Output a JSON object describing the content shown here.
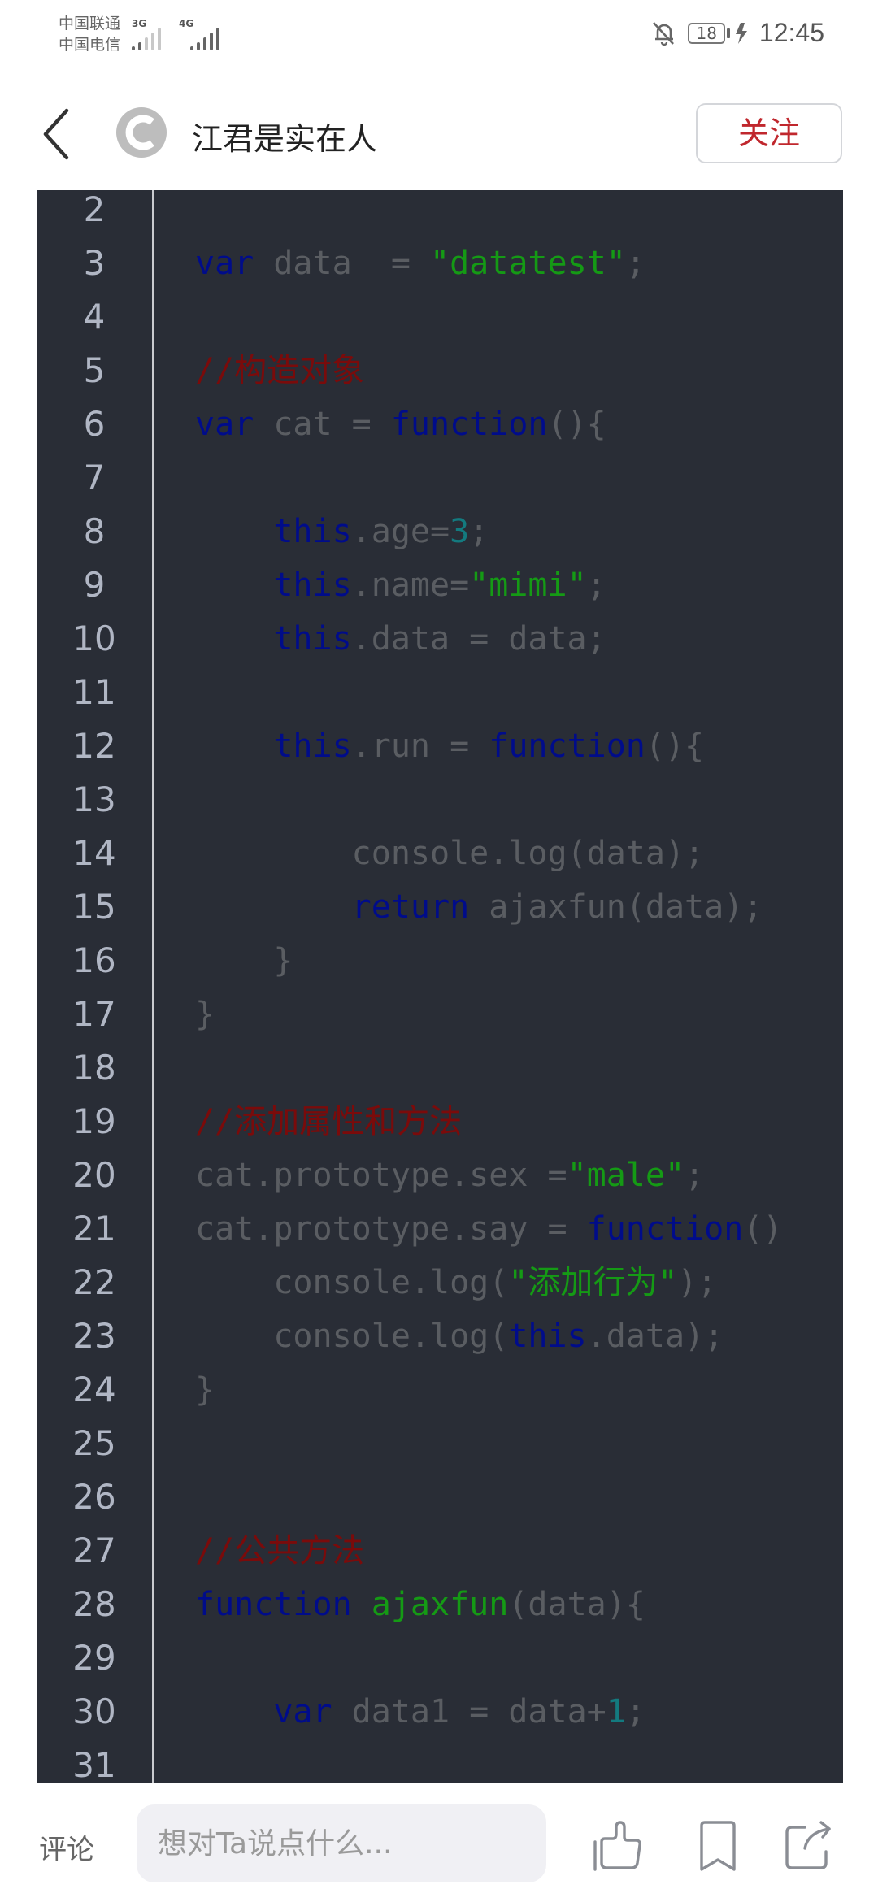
{
  "status_bar": {
    "carrier_1": "中国联通",
    "carrier_2": "中国电信",
    "network_1": "3G",
    "network_2": "4G",
    "icons": [
      "signal-3g-icon",
      "signal-4g-icon",
      "mute-bell-icon",
      "battery-icon",
      "charging-icon"
    ],
    "battery_level": "18",
    "time": "12:45"
  },
  "header": {
    "back_icon": "chevron-left-icon",
    "avatar_icon": "c-logo-avatar",
    "author_name": "江君是实在人",
    "follow_label": "关注",
    "follow_color": "#c0272d"
  },
  "code": {
    "colors": {
      "background": "#292d36",
      "keyword": "#000c8a",
      "string": "#159a15",
      "number": "#137a7f",
      "comment": "#7a0b0b",
      "plain": "#5a5d62",
      "line_number": "#b0b6c4"
    },
    "lines": [
      {
        "n": "2",
        "tokens": []
      },
      {
        "n": "3",
        "tokens": [
          {
            "t": "kw",
            "v": "var"
          },
          {
            "t": "pl",
            "v": " data  = "
          },
          {
            "t": "str",
            "v": "\"datatest\""
          },
          {
            "t": "pl",
            "v": ";"
          }
        ]
      },
      {
        "n": "4",
        "tokens": []
      },
      {
        "n": "5",
        "tokens": [
          {
            "t": "cm",
            "v": "//构造对象"
          }
        ]
      },
      {
        "n": "6",
        "tokens": [
          {
            "t": "kw",
            "v": "var"
          },
          {
            "t": "pl",
            "v": " cat = "
          },
          {
            "t": "kw",
            "v": "function"
          },
          {
            "t": "pl",
            "v": "(){"
          }
        ]
      },
      {
        "n": "7",
        "tokens": []
      },
      {
        "n": "8",
        "tokens": [
          {
            "t": "pl",
            "v": "    "
          },
          {
            "t": "kw",
            "v": "this"
          },
          {
            "t": "pl",
            "v": ".age="
          },
          {
            "t": "num",
            "v": "3"
          },
          {
            "t": "pl",
            "v": ";"
          }
        ]
      },
      {
        "n": "9",
        "tokens": [
          {
            "t": "pl",
            "v": "    "
          },
          {
            "t": "kw",
            "v": "this"
          },
          {
            "t": "pl",
            "v": ".name="
          },
          {
            "t": "str",
            "v": "\"mimi\""
          },
          {
            "t": "pl",
            "v": ";"
          }
        ]
      },
      {
        "n": "10",
        "tokens": [
          {
            "t": "pl",
            "v": "    "
          },
          {
            "t": "kw",
            "v": "this"
          },
          {
            "t": "pl",
            "v": ".data = data;"
          }
        ]
      },
      {
        "n": "11",
        "tokens": []
      },
      {
        "n": "12",
        "tokens": [
          {
            "t": "pl",
            "v": "    "
          },
          {
            "t": "kw",
            "v": "this"
          },
          {
            "t": "pl",
            "v": ".run = "
          },
          {
            "t": "kw",
            "v": "function"
          },
          {
            "t": "pl",
            "v": "(){"
          }
        ]
      },
      {
        "n": "13",
        "tokens": []
      },
      {
        "n": "14",
        "tokens": [
          {
            "t": "pl",
            "v": "        console.log(data);"
          }
        ]
      },
      {
        "n": "15",
        "tokens": [
          {
            "t": "pl",
            "v": "        "
          },
          {
            "t": "kw",
            "v": "return"
          },
          {
            "t": "pl",
            "v": " ajaxfun(data);"
          }
        ]
      },
      {
        "n": "16",
        "tokens": [
          {
            "t": "pl",
            "v": "    }"
          }
        ]
      },
      {
        "n": "17",
        "tokens": [
          {
            "t": "pl",
            "v": "}"
          }
        ]
      },
      {
        "n": "18",
        "tokens": []
      },
      {
        "n": "19",
        "tokens": [
          {
            "t": "cm",
            "v": "//添加属性和方法"
          }
        ]
      },
      {
        "n": "20",
        "tokens": [
          {
            "t": "pl",
            "v": "cat.prototype.sex ="
          },
          {
            "t": "str",
            "v": "\"male\""
          },
          {
            "t": "pl",
            "v": ";"
          }
        ]
      },
      {
        "n": "21",
        "tokens": [
          {
            "t": "pl",
            "v": "cat.prototype.say = "
          },
          {
            "t": "kw",
            "v": "function"
          },
          {
            "t": "pl",
            "v": "()"
          }
        ]
      },
      {
        "n": "22",
        "tokens": [
          {
            "t": "pl",
            "v": "    console.log("
          },
          {
            "t": "str",
            "v": "\"添加行为\""
          },
          {
            "t": "pl",
            "v": ");"
          }
        ]
      },
      {
        "n": "23",
        "tokens": [
          {
            "t": "pl",
            "v": "    console.log("
          },
          {
            "t": "kw",
            "v": "this"
          },
          {
            "t": "pl",
            "v": ".data);"
          }
        ]
      },
      {
        "n": "24",
        "tokens": [
          {
            "t": "pl",
            "v": "}"
          }
        ]
      },
      {
        "n": "25",
        "tokens": []
      },
      {
        "n": "26",
        "tokens": []
      },
      {
        "n": "27",
        "tokens": [
          {
            "t": "cm",
            "v": "//公共方法"
          }
        ]
      },
      {
        "n": "28",
        "tokens": [
          {
            "t": "kw",
            "v": "function"
          },
          {
            "t": "pl",
            "v": " "
          },
          {
            "t": "fn",
            "v": "ajaxfun"
          },
          {
            "t": "pl",
            "v": "(data){"
          }
        ]
      },
      {
        "n": "29",
        "tokens": []
      },
      {
        "n": "30",
        "tokens": [
          {
            "t": "pl",
            "v": "    "
          },
          {
            "t": "kw",
            "v": "var"
          },
          {
            "t": "pl",
            "v": " data1 = data+"
          },
          {
            "t": "num",
            "v": "1"
          },
          {
            "t": "pl",
            "v": ";"
          }
        ]
      },
      {
        "n": "31",
        "tokens": []
      }
    ]
  },
  "bottom_bar": {
    "comment_label": "评论",
    "comment_placeholder": "想对Ta说点什么...",
    "actions": [
      {
        "name": "like",
        "icon": "thumbs-up-icon"
      },
      {
        "name": "bookmark",
        "icon": "bookmark-icon"
      },
      {
        "name": "share",
        "icon": "share-icon"
      }
    ]
  }
}
